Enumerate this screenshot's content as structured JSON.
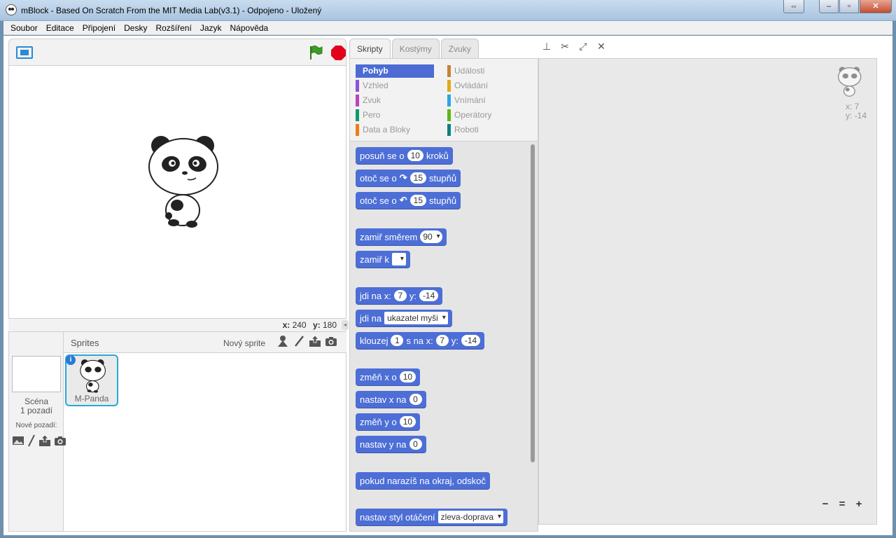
{
  "window": {
    "title": "mBlock - Based On Scratch From the MIT Media Lab(v3.1) - Odpojeno - Uložený"
  },
  "menu": [
    "Soubor",
    "Editace",
    "Připojení",
    "Desky",
    "Rozšíření",
    "Jazyk",
    "Nápověda"
  ],
  "stage": {
    "coords": {
      "x_label": "x:",
      "x": "240",
      "y_label": "y:",
      "y": "180"
    }
  },
  "sprites": {
    "title": "Sprites",
    "new_sprite_label": "Nový sprite",
    "scene_label": "Scéna",
    "backdrops_count": "1 pozadí",
    "new_backdrop_label": "Nové pozadí:",
    "selected_sprite_name": "M-Panda",
    "info_glyph": "i"
  },
  "tabs": [
    "Skripty",
    "Kostýmy",
    "Zvuky"
  ],
  "categories": [
    {
      "label": "Pohyb",
      "color": "#4c6cd4"
    },
    {
      "label": "Vzhled",
      "color": "#8a55d7"
    },
    {
      "label": "Zvuk",
      "color": "#bb42c3"
    },
    {
      "label": "Pero",
      "color": "#0e9a6c"
    },
    {
      "label": "Data a Bloky",
      "color": "#ee7d16"
    },
    {
      "label": "Události",
      "color": "#c88330"
    },
    {
      "label": "Ovládání",
      "color": "#e1a91a"
    },
    {
      "label": "Vnímání",
      "color": "#2ca5e2"
    },
    {
      "label": "Operátory",
      "color": "#5cb712"
    },
    {
      "label": "Roboti",
      "color": "#0e8080"
    }
  ],
  "blocks": {
    "move": {
      "pre": "posuň se o",
      "val": "10",
      "post": "kroků"
    },
    "turn_right": {
      "pre": "otoč se o",
      "val": "15",
      "post": "stupňů"
    },
    "turn_left": {
      "pre": "otoč se o",
      "val": "15",
      "post": "stupňů"
    },
    "point_direction": {
      "pre": "zamiř směrem",
      "val": "90"
    },
    "point_towards": {
      "pre": "zamiř k"
    },
    "goto_xy": {
      "pre": "jdi na x:",
      "x": "7",
      "ylabel": "y:",
      "y": "-14"
    },
    "goto": {
      "pre": "jdi na",
      "val": "ukazatel myši"
    },
    "glide": {
      "pre": "klouzej",
      "secs": "1",
      "mid": "s na x:",
      "x": "7",
      "ylabel": "y:",
      "y": "-14"
    },
    "change_x": {
      "pre": "změň x o",
      "val": "10"
    },
    "set_x": {
      "pre": "nastav x na",
      "val": "0"
    },
    "change_y": {
      "pre": "změň y o",
      "val": "10"
    },
    "set_y": {
      "pre": "nastav y na",
      "val": "0"
    },
    "bounce": {
      "pre": "pokud narazíš na okraj, odskoč"
    },
    "rotation_style": {
      "pre": "nastav styl otáčení",
      "val": "zleva-doprava"
    }
  },
  "script_area": {
    "x_label": "x:",
    "x": "7",
    "y_label": "y:",
    "y": "-14"
  },
  "zoom": [
    "−",
    "=",
    "+"
  ]
}
